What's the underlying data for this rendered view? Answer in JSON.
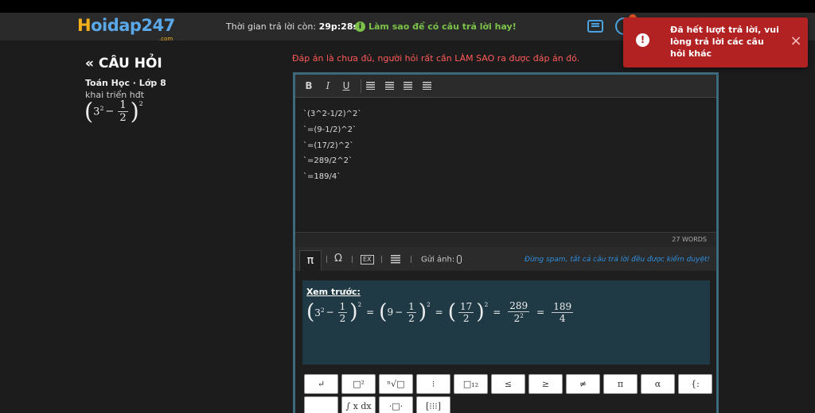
{
  "header": {
    "logo_h": "H",
    "logo_rest": "oidap247",
    "logo_com": ".com",
    "timer_label": "Thời gian trả lời còn:",
    "timer_value": "29p:28s",
    "howto_info": "i",
    "howto": "Làm sao để có câu trả lời hay!"
  },
  "toast": {
    "icon": "!",
    "message": "Đã hết lượt trả lời, vui lòng trả lời các câu hỏi khác",
    "close": "×"
  },
  "question": {
    "back": "«",
    "title": "CÂU HỎI",
    "subject": "Toán Học · Lớp 8",
    "text": "khai triển hđt",
    "math": {
      "base": "3",
      "exp": "2",
      "minus": "−",
      "num": "1",
      "den": "2",
      "outer_exp": "2"
    }
  },
  "warning": "Đáp án là chưa đủ, người hỏi rất cần LÀM SAO ra được đáp án đó.",
  "editor": {
    "toolbar": {
      "bold": "B",
      "italic": "I",
      "underline": "U"
    },
    "lines": [
      "`(3^2-1/2)^2`",
      "`=(9-1/2)^2`",
      "`=(17/2)^2`",
      "`=289/2^2`",
      "`=189/4`"
    ],
    "word_count": "27 WORDS"
  },
  "math_toolbar": {
    "pi": "π",
    "omega": "Ω",
    "ex": "EX",
    "send_image": "Gửi ảnh:",
    "spam_note": "Đừng spam, tất cả câu trả lời đều được kiểm duyệt!"
  },
  "preview": {
    "label": "Xem trước:",
    "t1": {
      "base": "3",
      "exp": "2",
      "minus": "−",
      "num": "1",
      "den": "2",
      "outer_exp": "2"
    },
    "t2": {
      "a": "9",
      "minus": "−",
      "num": "1",
      "den": "2",
      "outer_exp": "2"
    },
    "t3": {
      "num": "17",
      "den": "2",
      "outer_exp": "2"
    },
    "t4": {
      "num": "289",
      "den_base": "2",
      "den_exp": "2"
    },
    "t5": {
      "num": "189",
      "den": "4"
    },
    "eq": "="
  },
  "keys_row1": [
    "↵",
    "□²",
    "ⁿ√□",
    "⁝",
    "□₁₂",
    "≤",
    "≥",
    "≠",
    "π",
    "α",
    "{:"
  ],
  "keys_row2": [
    "",
    "∫ x dx",
    "·□·",
    "[⁝⁝⁝]"
  ]
}
